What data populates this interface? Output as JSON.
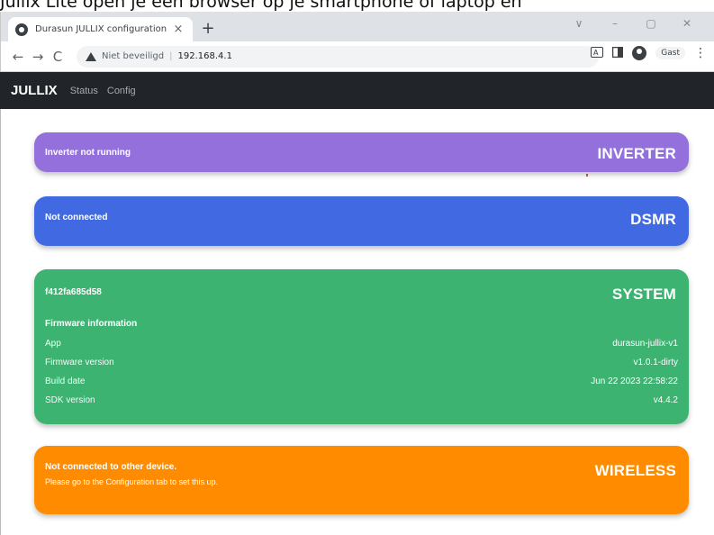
{
  "caption": "Jullix Lite open je een browser op je smartphone of laptop en",
  "browser": {
    "tab_title": "Durasun JULLIX configuration",
    "tab_close": "×",
    "new_tab": "+",
    "window_controls": [
      "∨",
      "–",
      "▢",
      "✕"
    ],
    "nav_back": "←",
    "nav_forward": "→",
    "nav_reload": "C",
    "security_label": "Niet beveiligd",
    "separator": "|",
    "url": "192.168.4.1",
    "profile_label": "Gast",
    "menu": "⋮"
  },
  "navbar": {
    "brand": "JULLIX",
    "links": [
      "Status",
      "Config"
    ]
  },
  "cards": {
    "inverter": {
      "title": "INVERTER",
      "message": "Inverter not running",
      "color": "#9370db"
    },
    "dsmr": {
      "title": "DSMR",
      "message": "Not connected",
      "color": "#4169e1"
    },
    "system": {
      "title": "SYSTEM",
      "message": "f412fa685d58",
      "color": "#3cb371",
      "firmware_heading": "Firmware information",
      "rows": [
        {
          "key": "App",
          "value": "durasun-jullix-v1"
        },
        {
          "key": "Firmware version",
          "value": "v1.0.1-dirty"
        },
        {
          "key": "Build date",
          "value": "Jun 22 2023 22:58:22"
        },
        {
          "key": "SDK version",
          "value": "v4.4.2"
        }
      ]
    },
    "wireless": {
      "title": "WIRELESS",
      "message": "Not connected to other device.",
      "sub": "Please go to the Configuration tab to set this up.",
      "color": "#ff8c00"
    }
  }
}
